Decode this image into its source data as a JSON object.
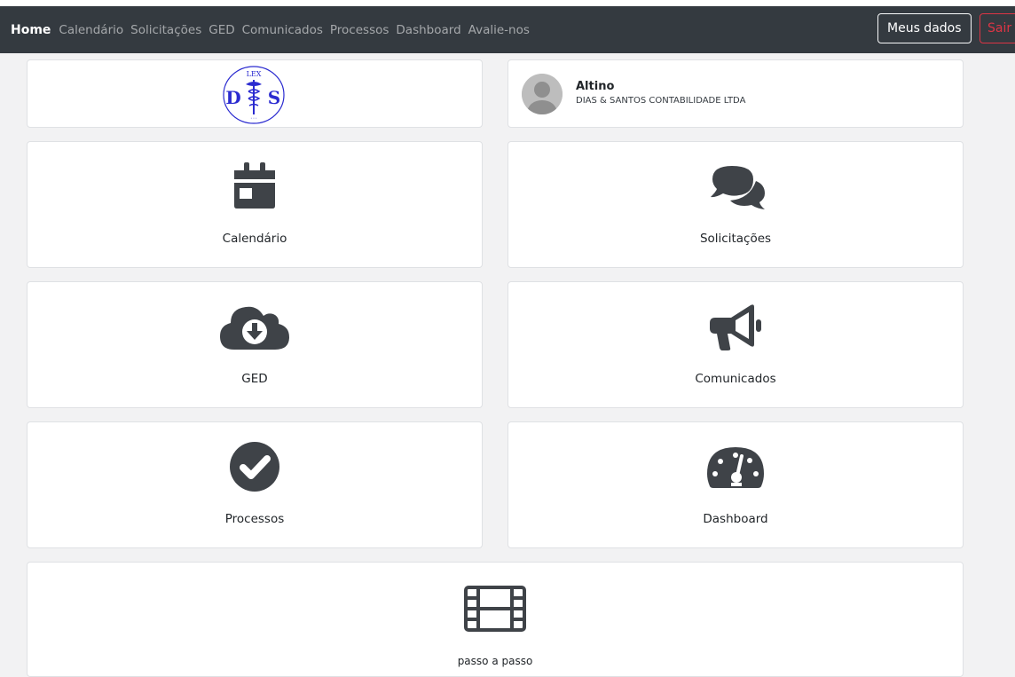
{
  "nav": {
    "brand": "Home",
    "links": [
      "Calendário",
      "Solicitações",
      "GED",
      "Comunicados",
      "Processos",
      "Dashboard",
      "Avalie-nos"
    ],
    "meus_dados": "Meus dados",
    "sair": "Sair"
  },
  "logo": {
    "top": "LEX",
    "left": "D",
    "right": "S"
  },
  "profile": {
    "name": "Altino",
    "company": "DIAS & SANTOS CONTABILIDADE LTDA"
  },
  "tiles": [
    {
      "label": "Calendário",
      "icon": "calendar-icon"
    },
    {
      "label": "Solicitações",
      "icon": "comments-icon"
    },
    {
      "label": "GED",
      "icon": "cloud-download-icon"
    },
    {
      "label": "Comunicados",
      "icon": "bullhorn-icon"
    },
    {
      "label": "Processos",
      "icon": "check-circle-icon"
    },
    {
      "label": "Dashboard",
      "icon": "tachometer-icon"
    }
  ],
  "tutorial": {
    "label": "passo a passo",
    "icon": "film-icon"
  },
  "colors": {
    "navbar": "#343a40",
    "icon": "#3f4348",
    "danger": "#dc3545",
    "logo": "#2b2bd0"
  }
}
